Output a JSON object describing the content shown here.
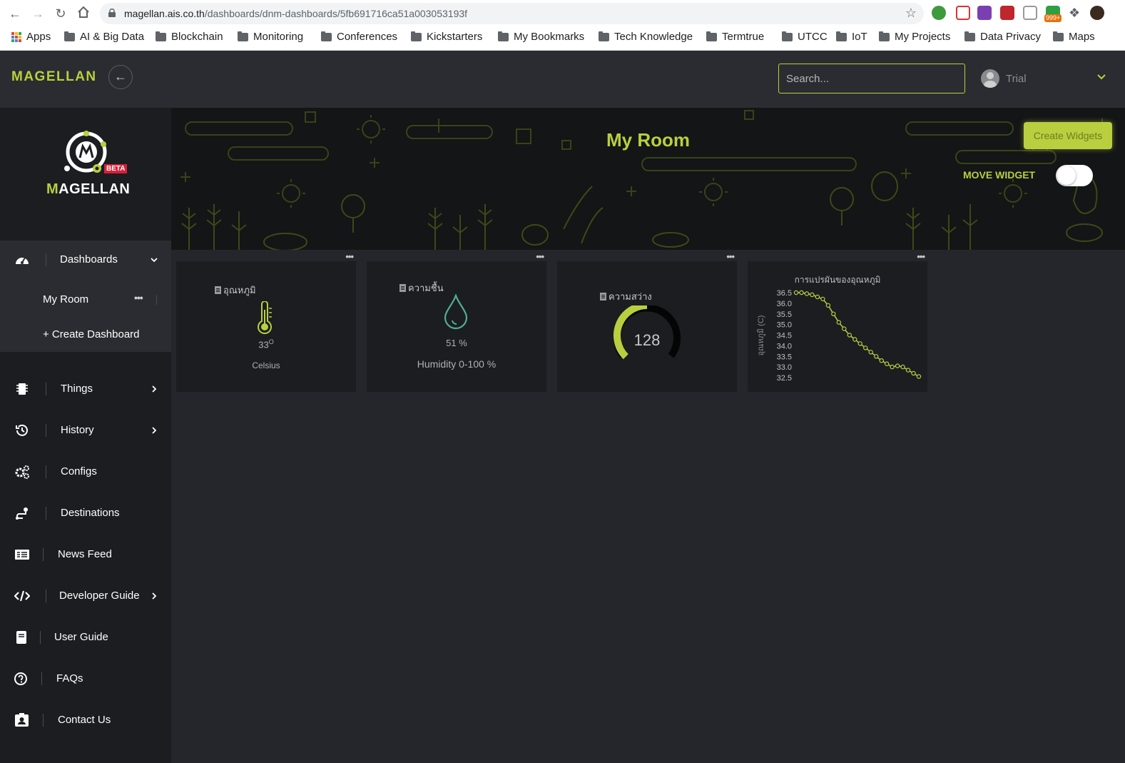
{
  "browser": {
    "url_host": "magellan.ais.co.th",
    "url_path": "/dashboards/dnm-dashboards/5fb691716ca51a003053193f",
    "bookmarks": [
      "Apps",
      "AI & Big Data",
      "Blockchain",
      "Monitoring",
      "Conferences",
      "Kickstarters",
      "My Bookmarks",
      "Tech Knowledge",
      "Termtrue",
      "UTCC",
      "IoT",
      "My Projects",
      "Data Privacy",
      "Maps"
    ],
    "badge": "999+"
  },
  "topbar": {
    "brand": "MAGELLAN",
    "search_placeholder": "Search...",
    "user": "Trial"
  },
  "sidebar": {
    "logo_text": "AGELLAN",
    "logo_m": "M",
    "beta": "BETA",
    "dashboards_label": "Dashboards",
    "sub_items": [
      "My Room",
      "+ Create Dashboard"
    ],
    "items": [
      {
        "label": "Things",
        "icon": "chip-icon"
      },
      {
        "label": "History",
        "icon": "history-icon"
      },
      {
        "label": "Configs",
        "icon": "gears-icon"
      },
      {
        "label": "Destinations",
        "icon": "route-icon"
      },
      {
        "label": "News Feed",
        "icon": "newspaper-icon"
      },
      {
        "label": "Developer Guide",
        "icon": "code-icon"
      },
      {
        "label": "User Guide",
        "icon": "book-icon"
      },
      {
        "label": "FAQs",
        "icon": "question-icon"
      },
      {
        "label": "Contact Us",
        "icon": "contact-icon"
      }
    ]
  },
  "page": {
    "title": "My Room",
    "create_widgets": "Create Widgets",
    "move_widget": "MOVE WIDGET",
    "move_widget_on": false
  },
  "widgets": {
    "temperature": {
      "title": "อุณหภูมิ",
      "value": "33",
      "unit_sup": "O",
      "caption": "Celsius"
    },
    "humidity": {
      "title": "ความชื้น",
      "value": "51 %",
      "caption": "Humidity 0-100 %"
    },
    "light": {
      "title": "ความสว่าง",
      "value": "128",
      "gauge_fraction": 0.5
    }
  },
  "chart_data": {
    "type": "line",
    "title": "การแปรผันของอุณหภูมิ",
    "ylabel": "อุณหภูมิ (C)",
    "xlabel": "",
    "ylim": [
      32.5,
      36.5
    ],
    "yticks": [
      36.5,
      36.0,
      35.5,
      35.0,
      34.5,
      34.0,
      33.5,
      33.0,
      32.5
    ],
    "values": [
      36.5,
      36.5,
      36.45,
      36.4,
      36.3,
      36.2,
      35.9,
      35.5,
      35.1,
      34.8,
      34.5,
      34.3,
      34.1,
      33.9,
      33.7,
      33.5,
      33.3,
      33.15,
      33.0,
      33.05,
      33.0,
      32.85,
      32.7,
      32.55
    ]
  },
  "colors": {
    "accent": "#b9cf3f",
    "humidity_icon": "#4fb08a",
    "background": "#25262b",
    "card": "#1c1d21"
  }
}
